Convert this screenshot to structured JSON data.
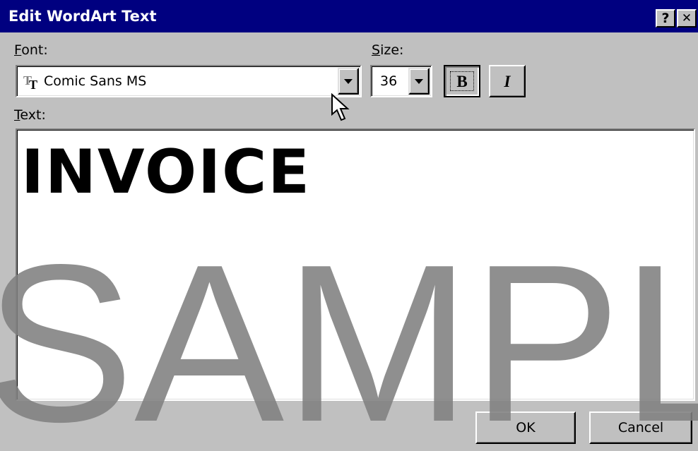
{
  "window": {
    "title": "Edit WordArt Text",
    "help_button": "?",
    "close_button": "✕"
  },
  "font": {
    "label_accel": "F",
    "label_rest": "ont:",
    "value": "Comic Sans MS",
    "icon": "truetype-font-icon"
  },
  "size": {
    "label_accel": "S",
    "label_rest": "ize:",
    "value": "36"
  },
  "format": {
    "bold_label": "B",
    "italic_label": "I"
  },
  "text": {
    "label_accel": "T",
    "label_rest": "ext:",
    "value": "INVOICE"
  },
  "buttons": {
    "ok_label": "OK",
    "cancel_label": "Cancel"
  },
  "watermark": "SAMPL",
  "colors": {
    "titlebar": "#000080",
    "face": "#c0c0c0",
    "field": "#ffffff"
  }
}
